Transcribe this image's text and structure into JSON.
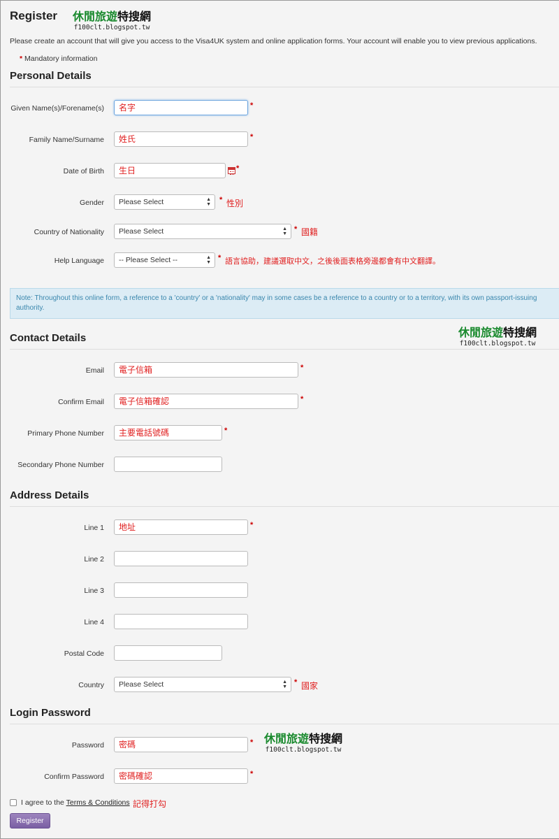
{
  "header": {
    "title": "Register",
    "intro": "Please create an account that will give you access to the Visa4UK system and online application forms. Your account will enable you to view previous applications.",
    "mandatory_star": "*",
    "mandatory_text": "Mandatory information"
  },
  "watermark": {
    "green": "休閒旅遊",
    "black": "特搜網",
    "url": "f100clt.blogspot.tw"
  },
  "personal": {
    "heading": "Personal Details",
    "given_label": "Given Name(s)/Forename(s)",
    "given_value": "名字",
    "family_label": "Family Name/Surname",
    "family_value": "姓氏",
    "dob_label": "Date of Birth",
    "dob_value": "生日",
    "gender_label": "Gender",
    "gender_value": "Please Select",
    "gender_note": "性別",
    "nationality_label": "Country of Nationality",
    "nationality_value": "Please Select",
    "nationality_note": "國籍",
    "helplang_label": "Help Language",
    "helplang_value": "-- Please Select --",
    "helplang_note": "語言協助，建議選取中文，之後後面表格旁邊都會有中文翻譯。"
  },
  "info_note": "Note: Throughout this online form, a reference to a 'country' or a 'nationality' may in some cases be a reference to a country or to a territory, with its own passport-issuing authority.",
  "contact": {
    "heading": "Contact Details",
    "email_label": "Email",
    "email_value": "電子信箱",
    "confirm_email_label": "Confirm Email",
    "confirm_email_value": "電子信箱確認",
    "primary_phone_label": "Primary Phone Number",
    "primary_phone_value": "主要電話號碼",
    "secondary_phone_label": "Secondary Phone Number",
    "secondary_phone_value": ""
  },
  "address": {
    "heading": "Address Details",
    "line1_label": "Line 1",
    "line1_value": "地址",
    "line2_label": "Line 2",
    "line3_label": "Line 3",
    "line4_label": "Line 4",
    "postal_label": "Postal Code",
    "country_label": "Country",
    "country_value": "Please Select",
    "country_note": "國家"
  },
  "login": {
    "heading": "Login Password",
    "password_label": "Password",
    "password_value": "密碼",
    "confirm_password_label": "Confirm Password",
    "confirm_password_value": "密碼確認"
  },
  "agree": {
    "prefix": "I agree to the ",
    "link": "Terms & Conditions",
    "note": "記得打勾"
  },
  "register_button": "Register",
  "colors": {
    "annotation_red": "#e02020",
    "watermark_green": "#1a8a2e",
    "button_purple": "#7a5fa3",
    "note_blue": "#3a87ad"
  }
}
